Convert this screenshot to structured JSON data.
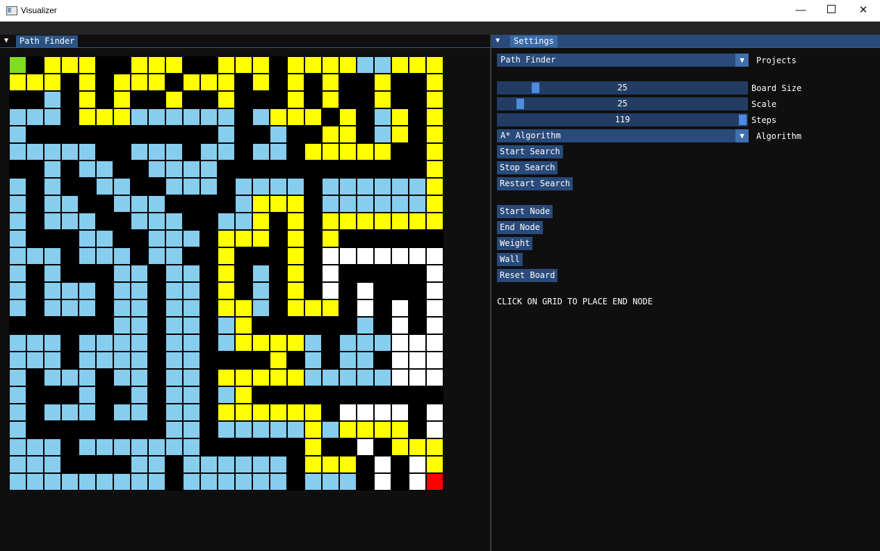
{
  "window": {
    "title": "Visualizer",
    "minimize_icon": "minimize-icon",
    "maximize_icon": "maximize-icon",
    "close_icon": "close-icon"
  },
  "left_panel": {
    "tab_label": "Path Finder"
  },
  "settings": {
    "tab_label": "Settings",
    "project": {
      "value": "Path Finder",
      "label": "Projects"
    },
    "sliders": [
      {
        "label": "Board Size",
        "value": "25",
        "fraction": 0.13
      },
      {
        "label": "Scale",
        "value": "25",
        "fraction": 0.07
      },
      {
        "label": "Steps",
        "value": "119",
        "fraction": 1.0
      }
    ],
    "algorithm": {
      "value": "A* Algorithm",
      "label": "Algorithm"
    },
    "buttons": {
      "start_search": "Start Search",
      "stop_search": "Stop Search",
      "restart_search": "Restart Search",
      "start_node": "Start Node",
      "end_node": "End Node",
      "weight": "Weight",
      "wall": "Wall",
      "reset_board": "Reset Board"
    },
    "message": "CLICK ON GRID TO PLACE END NODE"
  },
  "board": {
    "size": 25,
    "legend": {
      "0": "wall",
      "1": "unvisited",
      "2": "visited",
      "3": "path",
      "4": "start",
      "5": "end"
    },
    "colors": {
      "0": "#000000",
      "1": "#87cdee",
      "2": "#ffffff",
      "3": "#ffff00",
      "4": "#7fdc21",
      "5": "#ff0000"
    },
    "rows": [
      "4033300333003330333311333",
      "3330303330333030303003003",
      "0010303003003000303003003",
      "1110333111111013330301303",
      "1000000000001001003301303",
      "1111100111011011033333003",
      "0010110011110000000000003",
      "1010011001110111101111113",
      "1011001110000133301111113",
      "1011100111001130303333333",
      "1000110011103330303000000",
      "1110111011003000302222222",
      "1010001101103010302000002",
      "1011101101103010302020002",
      "1011101101103310333020202",
      "0000001101101300000010202",
      "1110111101101333310111222",
      "1110111101100003010110222",
      "1011101101103333311111222",
      "1000100101101300000000000",
      "1011101101103333330222202",
      "1000000001101111131333302",
      "1110111111100000030020333",
      "1110000110111111033302023",
      "1111111110111111011102025"
    ]
  }
}
